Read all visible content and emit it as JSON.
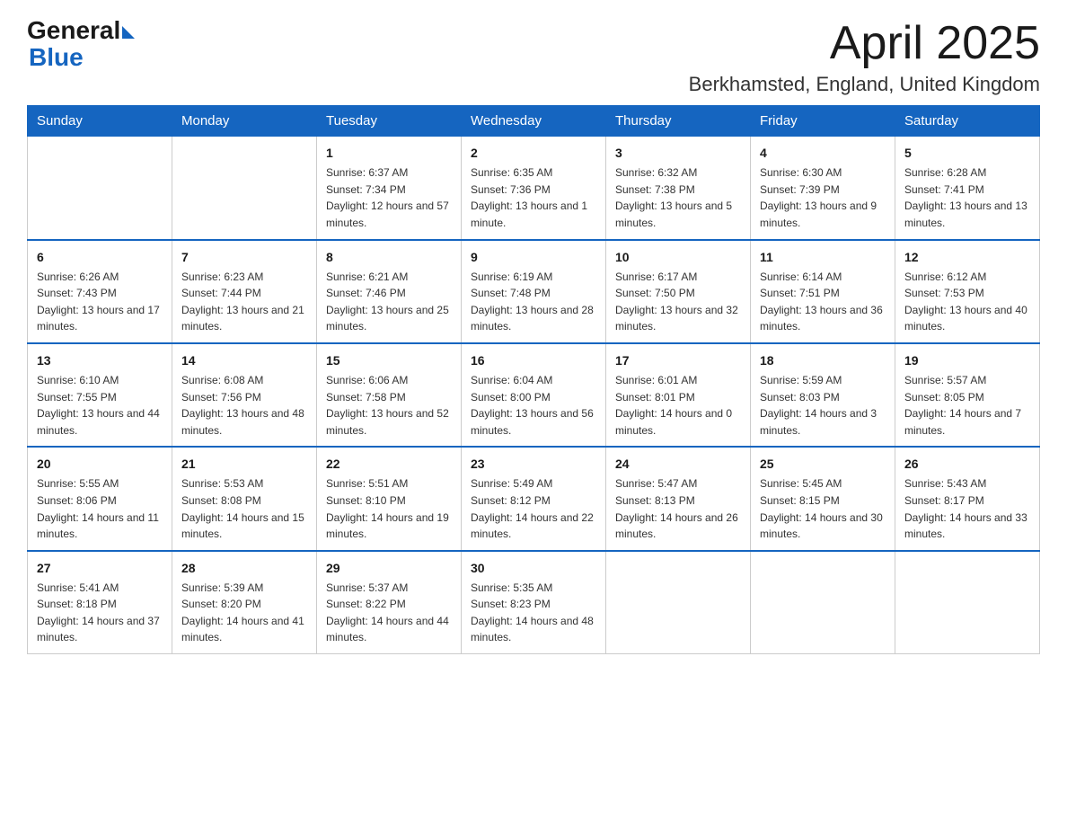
{
  "header": {
    "logo_general": "General",
    "logo_blue": "Blue",
    "month_title": "April 2025",
    "location": "Berkhamsted, England, United Kingdom"
  },
  "days_of_week": [
    "Sunday",
    "Monday",
    "Tuesday",
    "Wednesday",
    "Thursday",
    "Friday",
    "Saturday"
  ],
  "weeks": [
    [
      {
        "day": "",
        "sunrise": "",
        "sunset": "",
        "daylight": ""
      },
      {
        "day": "",
        "sunrise": "",
        "sunset": "",
        "daylight": ""
      },
      {
        "day": "1",
        "sunrise": "Sunrise: 6:37 AM",
        "sunset": "Sunset: 7:34 PM",
        "daylight": "Daylight: 12 hours and 57 minutes."
      },
      {
        "day": "2",
        "sunrise": "Sunrise: 6:35 AM",
        "sunset": "Sunset: 7:36 PM",
        "daylight": "Daylight: 13 hours and 1 minute."
      },
      {
        "day": "3",
        "sunrise": "Sunrise: 6:32 AM",
        "sunset": "Sunset: 7:38 PM",
        "daylight": "Daylight: 13 hours and 5 minutes."
      },
      {
        "day": "4",
        "sunrise": "Sunrise: 6:30 AM",
        "sunset": "Sunset: 7:39 PM",
        "daylight": "Daylight: 13 hours and 9 minutes."
      },
      {
        "day": "5",
        "sunrise": "Sunrise: 6:28 AM",
        "sunset": "Sunset: 7:41 PM",
        "daylight": "Daylight: 13 hours and 13 minutes."
      }
    ],
    [
      {
        "day": "6",
        "sunrise": "Sunrise: 6:26 AM",
        "sunset": "Sunset: 7:43 PM",
        "daylight": "Daylight: 13 hours and 17 minutes."
      },
      {
        "day": "7",
        "sunrise": "Sunrise: 6:23 AM",
        "sunset": "Sunset: 7:44 PM",
        "daylight": "Daylight: 13 hours and 21 minutes."
      },
      {
        "day": "8",
        "sunrise": "Sunrise: 6:21 AM",
        "sunset": "Sunset: 7:46 PM",
        "daylight": "Daylight: 13 hours and 25 minutes."
      },
      {
        "day": "9",
        "sunrise": "Sunrise: 6:19 AM",
        "sunset": "Sunset: 7:48 PM",
        "daylight": "Daylight: 13 hours and 28 minutes."
      },
      {
        "day": "10",
        "sunrise": "Sunrise: 6:17 AM",
        "sunset": "Sunset: 7:50 PM",
        "daylight": "Daylight: 13 hours and 32 minutes."
      },
      {
        "day": "11",
        "sunrise": "Sunrise: 6:14 AM",
        "sunset": "Sunset: 7:51 PM",
        "daylight": "Daylight: 13 hours and 36 minutes."
      },
      {
        "day": "12",
        "sunrise": "Sunrise: 6:12 AM",
        "sunset": "Sunset: 7:53 PM",
        "daylight": "Daylight: 13 hours and 40 minutes."
      }
    ],
    [
      {
        "day": "13",
        "sunrise": "Sunrise: 6:10 AM",
        "sunset": "Sunset: 7:55 PM",
        "daylight": "Daylight: 13 hours and 44 minutes."
      },
      {
        "day": "14",
        "sunrise": "Sunrise: 6:08 AM",
        "sunset": "Sunset: 7:56 PM",
        "daylight": "Daylight: 13 hours and 48 minutes."
      },
      {
        "day": "15",
        "sunrise": "Sunrise: 6:06 AM",
        "sunset": "Sunset: 7:58 PM",
        "daylight": "Daylight: 13 hours and 52 minutes."
      },
      {
        "day": "16",
        "sunrise": "Sunrise: 6:04 AM",
        "sunset": "Sunset: 8:00 PM",
        "daylight": "Daylight: 13 hours and 56 minutes."
      },
      {
        "day": "17",
        "sunrise": "Sunrise: 6:01 AM",
        "sunset": "Sunset: 8:01 PM",
        "daylight": "Daylight: 14 hours and 0 minutes."
      },
      {
        "day": "18",
        "sunrise": "Sunrise: 5:59 AM",
        "sunset": "Sunset: 8:03 PM",
        "daylight": "Daylight: 14 hours and 3 minutes."
      },
      {
        "day": "19",
        "sunrise": "Sunrise: 5:57 AM",
        "sunset": "Sunset: 8:05 PM",
        "daylight": "Daylight: 14 hours and 7 minutes."
      }
    ],
    [
      {
        "day": "20",
        "sunrise": "Sunrise: 5:55 AM",
        "sunset": "Sunset: 8:06 PM",
        "daylight": "Daylight: 14 hours and 11 minutes."
      },
      {
        "day": "21",
        "sunrise": "Sunrise: 5:53 AM",
        "sunset": "Sunset: 8:08 PM",
        "daylight": "Daylight: 14 hours and 15 minutes."
      },
      {
        "day": "22",
        "sunrise": "Sunrise: 5:51 AM",
        "sunset": "Sunset: 8:10 PM",
        "daylight": "Daylight: 14 hours and 19 minutes."
      },
      {
        "day": "23",
        "sunrise": "Sunrise: 5:49 AM",
        "sunset": "Sunset: 8:12 PM",
        "daylight": "Daylight: 14 hours and 22 minutes."
      },
      {
        "day": "24",
        "sunrise": "Sunrise: 5:47 AM",
        "sunset": "Sunset: 8:13 PM",
        "daylight": "Daylight: 14 hours and 26 minutes."
      },
      {
        "day": "25",
        "sunrise": "Sunrise: 5:45 AM",
        "sunset": "Sunset: 8:15 PM",
        "daylight": "Daylight: 14 hours and 30 minutes."
      },
      {
        "day": "26",
        "sunrise": "Sunrise: 5:43 AM",
        "sunset": "Sunset: 8:17 PM",
        "daylight": "Daylight: 14 hours and 33 minutes."
      }
    ],
    [
      {
        "day": "27",
        "sunrise": "Sunrise: 5:41 AM",
        "sunset": "Sunset: 8:18 PM",
        "daylight": "Daylight: 14 hours and 37 minutes."
      },
      {
        "day": "28",
        "sunrise": "Sunrise: 5:39 AM",
        "sunset": "Sunset: 8:20 PM",
        "daylight": "Daylight: 14 hours and 41 minutes."
      },
      {
        "day": "29",
        "sunrise": "Sunrise: 5:37 AM",
        "sunset": "Sunset: 8:22 PM",
        "daylight": "Daylight: 14 hours and 44 minutes."
      },
      {
        "day": "30",
        "sunrise": "Sunrise: 5:35 AM",
        "sunset": "Sunset: 8:23 PM",
        "daylight": "Daylight: 14 hours and 48 minutes."
      },
      {
        "day": "",
        "sunrise": "",
        "sunset": "",
        "daylight": ""
      },
      {
        "day": "",
        "sunrise": "",
        "sunset": "",
        "daylight": ""
      },
      {
        "day": "",
        "sunrise": "",
        "sunset": "",
        "daylight": ""
      }
    ]
  ]
}
